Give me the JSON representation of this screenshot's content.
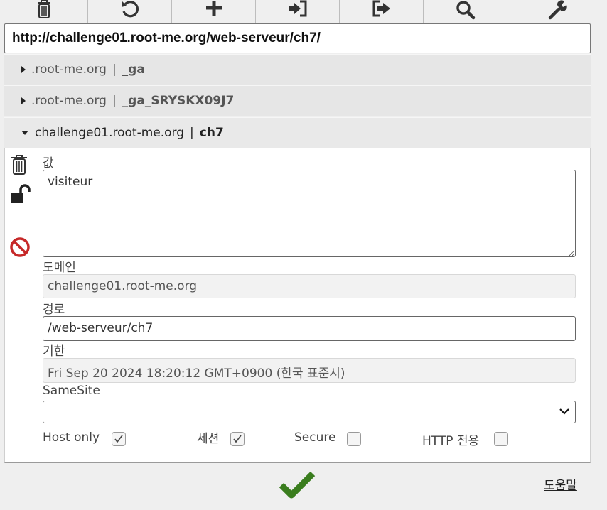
{
  "toolbar": {
    "buttons": [
      {
        "icon": "trash-icon"
      },
      {
        "icon": "refresh-icon"
      },
      {
        "icon": "plus-icon"
      },
      {
        "icon": "import-icon"
      },
      {
        "icon": "export-icon"
      },
      {
        "icon": "search-icon"
      },
      {
        "icon": "wrench-icon"
      }
    ]
  },
  "url": "http://challenge01.root-me.org/web-serveur/ch7/",
  "cookies": [
    {
      "domain": ".root-me.org",
      "separator": "|",
      "name": "_ga",
      "expanded": false
    },
    {
      "domain": ".root-me.org",
      "separator": "|",
      "name": "_ga_SRYSKX09J7",
      "expanded": false
    },
    {
      "domain": "challenge01.root-me.org",
      "separator": "|",
      "name": "ch7",
      "expanded": true
    }
  ],
  "detail": {
    "value_label": "값",
    "value": "visiteur",
    "domain_label": "도메인",
    "domain": "challenge01.root-me.org",
    "path_label": "경로",
    "path": "/web-serveur/ch7",
    "expires_label": "기한",
    "expires": "Fri Sep 20 2024 18:20:12 GMT+0900 (한국 표준시)",
    "samesite_label": "SameSite",
    "samesite_value": "",
    "host_only_label": "Host only",
    "host_only": true,
    "session_label": "세션",
    "session": true,
    "secure_label": "Secure",
    "secure": false,
    "http_only_label": "HTTP 전용",
    "http_only": false
  },
  "help_link": "도움말",
  "colors": {
    "accent_green": "#3a7d1e",
    "block_red": "#c62828"
  }
}
